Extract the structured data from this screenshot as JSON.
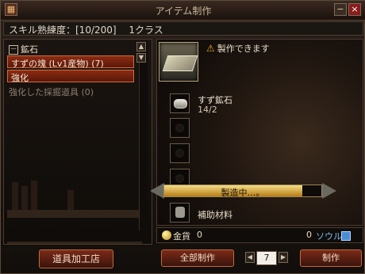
{
  "window": {
    "title": "アイテム制作"
  },
  "titlebar_buttons": {
    "minimize": "−",
    "close": "×"
  },
  "skill": {
    "text": "スキル熟練度：[10/200]　 1クラス"
  },
  "tree": {
    "categories": [
      {
        "label": "鉱石",
        "expander": "－"
      },
      {
        "label": "強化"
      }
    ],
    "items": [
      {
        "label": "すずの塊 (Lv1産物) (7)",
        "selected": true
      },
      {
        "label": "強化した採掘道具 (0)",
        "selected": false
      }
    ]
  },
  "scroll": {
    "up": "▲",
    "down": "▼"
  },
  "left_button": {
    "label": "道具加工店"
  },
  "item": {
    "status_text": "製作できます",
    "status_icon": "warning-triangle-icon"
  },
  "materials": [
    {
      "name": "すず鉱石",
      "count": "14/2"
    }
  ],
  "aux": {
    "label": "補助材料"
  },
  "progress": {
    "label": "製造中…。",
    "percent": 0.88
  },
  "currency": {
    "gold_label": "金貨",
    "gold_value": "0",
    "soul_value": "0",
    "soul_label": "ソウル"
  },
  "buttons": {
    "craft_all": "全部制作",
    "craft": "制作"
  },
  "quantity": {
    "value": "7",
    "left_arrow": "◀",
    "right_arrow": "▶"
  }
}
